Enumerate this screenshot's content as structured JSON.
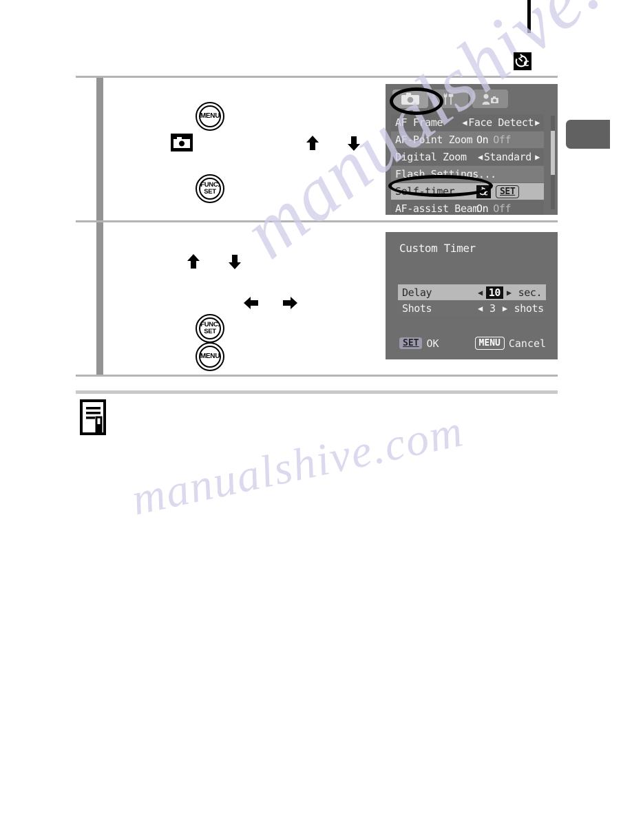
{
  "page": {
    "corner_icon": "custom-self-timer-icon",
    "note_icon": "note-memo-icon",
    "side_tab": "chapter-thumb-tab"
  },
  "step1": {
    "buttons": [
      {
        "name": "menu-button",
        "label_top": "MENU",
        "label_bottom": ""
      },
      {
        "name": "func-set-button",
        "label_top": "FUNC.",
        "label_bottom": "SET"
      }
    ],
    "shooting_mode_icon": "camera-record-icon",
    "arrows": [
      "arrow-up-icon",
      "arrow-down-icon"
    ],
    "screen": {
      "tabs": [
        {
          "name": "tab-shooting",
          "icon": "camera-icon",
          "selected": true
        },
        {
          "name": "tab-setup",
          "icon": "tools-icon",
          "selected": false
        },
        {
          "name": "tab-my-camera",
          "icon": "my-camera-icon",
          "selected": false
        }
      ],
      "rows": [
        {
          "label": "AF Frame",
          "value": "Face Detect",
          "type": "arrows",
          "style": "alt"
        },
        {
          "label": "AF-Point Zoom",
          "on": "On",
          "off": "Off",
          "type": "onoff",
          "style": "plain"
        },
        {
          "label": "Digital Zoom",
          "value": "Standard",
          "type": "arrows",
          "style": "alt"
        },
        {
          "label": "Flash Settings...",
          "value": "",
          "type": "plain",
          "style": "plain"
        },
        {
          "label": "Self-timer",
          "value": "SET",
          "type": "setchip",
          "style": "sel"
        },
        {
          "label": "AF-assist Beam",
          "on": "On",
          "off": "Off",
          "type": "onoff",
          "style": "alt"
        }
      ],
      "caret_left": "◀",
      "caret_right": "▶",
      "timer_chip_icon": "custom-self-timer-icon"
    }
  },
  "step2": {
    "buttons": [
      {
        "name": "func-set-button",
        "label_top": "FUNC.",
        "label_bottom": "SET"
      },
      {
        "name": "menu-button",
        "label_top": "MENU",
        "label_bottom": ""
      }
    ],
    "arrows": [
      "arrow-up-icon",
      "arrow-down-icon",
      "arrow-left-icon",
      "arrow-right-icon"
    ],
    "screen": {
      "title": "Custom Timer",
      "rows": [
        {
          "label": "Delay",
          "value": "10",
          "unit": "sec.",
          "selected": true
        },
        {
          "label": "Shots",
          "value": "3",
          "unit": "shots",
          "selected": false
        }
      ],
      "caret_left": "◀",
      "caret_right": "▶",
      "footer": {
        "set_chip": "SET",
        "set_label": "OK",
        "menu_chip": "MENU",
        "menu_label": "Cancel"
      }
    }
  },
  "watermark": {
    "line1": "manualshive.com",
    "line2": "manualshive.com"
  }
}
